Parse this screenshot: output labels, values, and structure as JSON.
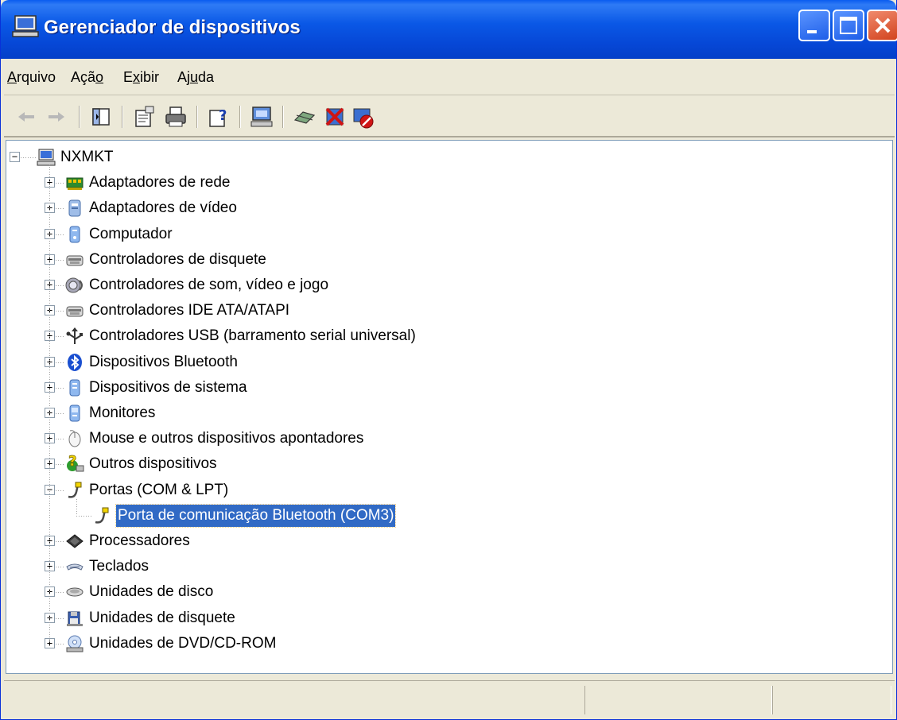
{
  "window": {
    "title": "Gerenciador de dispositivos",
    "icon": "computer-icon"
  },
  "title_buttons": {
    "minimize": "minimize-icon",
    "maximize": "maximize-icon",
    "close": "close-icon"
  },
  "menu": {
    "items": [
      {
        "label": "Arquivo",
        "accesskey": "A"
      },
      {
        "label": "Ação",
        "accesskey": "o"
      },
      {
        "label": "Exibir",
        "accesskey": "x"
      },
      {
        "label": "Ajuda",
        "accesskey": "u"
      }
    ]
  },
  "toolbar": {
    "buttons": [
      {
        "name": "back-icon"
      },
      {
        "name": "forward-icon"
      },
      {
        "name": "show-hide-console-tree-icon"
      },
      {
        "name": "properties-icon"
      },
      {
        "name": "print-icon"
      },
      {
        "name": "help-icon"
      },
      {
        "name": "scan-hardware-changes-icon"
      },
      {
        "name": "update-driver-icon"
      },
      {
        "name": "uninstall-icon"
      },
      {
        "name": "disable-icon"
      }
    ]
  },
  "tree": {
    "root": {
      "label": "NXMKT",
      "icon": "computer-icon",
      "expanded": true
    },
    "items": [
      {
        "label": "Adaptadores de rede",
        "icon": "network-adapter-icon",
        "expanded": false
      },
      {
        "label": "Adaptadores de vídeo",
        "icon": "display-adapter-icon",
        "expanded": false
      },
      {
        "label": "Computador",
        "icon": "computer-device-icon",
        "expanded": false
      },
      {
        "label": "Controladores de disquete",
        "icon": "floppy-controller-icon",
        "expanded": false
      },
      {
        "label": "Controladores de som, vídeo e jogo",
        "icon": "sound-icon",
        "expanded": false
      },
      {
        "label": "Controladores IDE ATA/ATAPI",
        "icon": "ide-controller-icon",
        "expanded": false
      },
      {
        "label": "Controladores USB (barramento serial universal)",
        "icon": "usb-icon",
        "expanded": false
      },
      {
        "label": "Dispositivos Bluetooth",
        "icon": "bluetooth-icon",
        "expanded": false
      },
      {
        "label": "Dispositivos de sistema",
        "icon": "system-device-icon",
        "expanded": false
      },
      {
        "label": "Monitores",
        "icon": "monitor-icon",
        "expanded": false
      },
      {
        "label": "Mouse e outros dispositivos apontadores",
        "icon": "mouse-icon",
        "expanded": false
      },
      {
        "label": "Outros dispositivos",
        "icon": "unknown-device-icon",
        "expanded": false
      },
      {
        "label": "Portas (COM & LPT)",
        "icon": "port-icon",
        "expanded": true,
        "children": [
          {
            "label": "Porta de comunicação Bluetooth (COM3)",
            "icon": "port-icon",
            "selected": true
          }
        ]
      },
      {
        "label": "Processadores",
        "icon": "processor-icon",
        "expanded": false
      },
      {
        "label": "Teclados",
        "icon": "keyboard-icon",
        "expanded": false
      },
      {
        "label": "Unidades de disco",
        "icon": "disk-drive-icon",
        "expanded": false
      },
      {
        "label": "Unidades de disquete",
        "icon": "floppy-drive-icon",
        "expanded": false
      },
      {
        "label": "Unidades de DVD/CD-ROM",
        "icon": "dvd-drive-icon",
        "expanded": false
      }
    ]
  },
  "expander_glyphs": {
    "collapsed": "+",
    "expanded": "−"
  },
  "colors": {
    "titlebar": "#0a58e6",
    "selection": "#316ac5",
    "chrome": "#ece9d8"
  }
}
